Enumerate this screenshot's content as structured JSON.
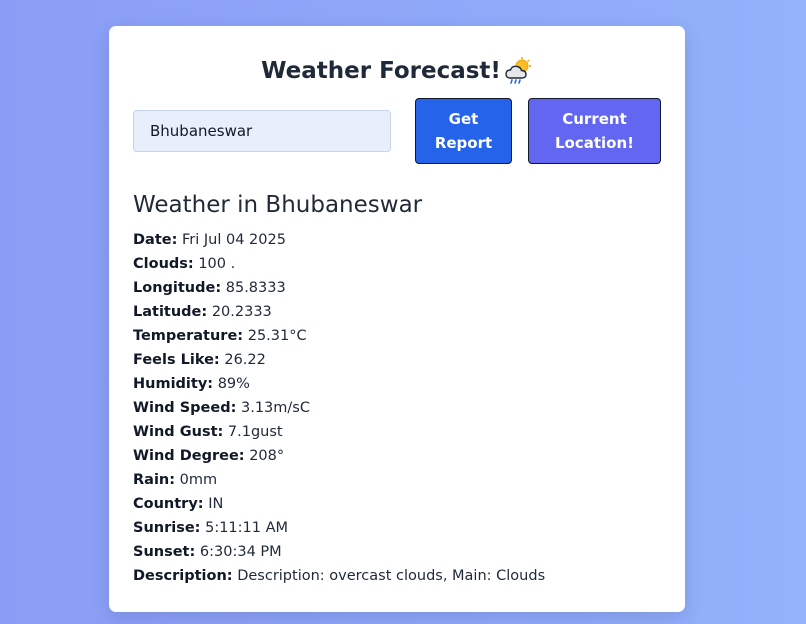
{
  "header": {
    "title": "Weather Forecast!",
    "icon": "cloud-sun-rain-icon"
  },
  "search": {
    "value": "Bhubaneswar"
  },
  "buttons": {
    "get_report": "Get Report",
    "current_location": "Current Location!"
  },
  "report": {
    "heading": "Weather in Bhubaneswar",
    "fields": [
      {
        "label": "Date:",
        "value": "Fri Jul 04 2025"
      },
      {
        "label": "Clouds:",
        "value": "100 ."
      },
      {
        "label": "Longitude:",
        "value": "85.8333"
      },
      {
        "label": "Latitude:",
        "value": "20.2333"
      },
      {
        "label": "Temperature:",
        "value": "25.31°C"
      },
      {
        "label": "Feels Like:",
        "value": "26.22"
      },
      {
        "label": "Humidity:",
        "value": "89%"
      },
      {
        "label": "Wind Speed:",
        "value": "3.13m/sC"
      },
      {
        "label": "Wind Gust:",
        "value": "7.1gust"
      },
      {
        "label": "Wind Degree:",
        "value": "208°"
      },
      {
        "label": "Rain:",
        "value": "0mm"
      },
      {
        "label": "Country:",
        "value": "IN"
      },
      {
        "label": "Sunrise:",
        "value": "5:11:11 AM"
      },
      {
        "label": "Sunset:",
        "value": "6:30:34 PM"
      },
      {
        "label": "Description:",
        "value": "Description: overcast clouds, Main: Clouds"
      }
    ]
  },
  "colors": {
    "primary_button": "#2563eb",
    "secondary_button": "#6366f1",
    "input_bg": "#e8effc"
  }
}
